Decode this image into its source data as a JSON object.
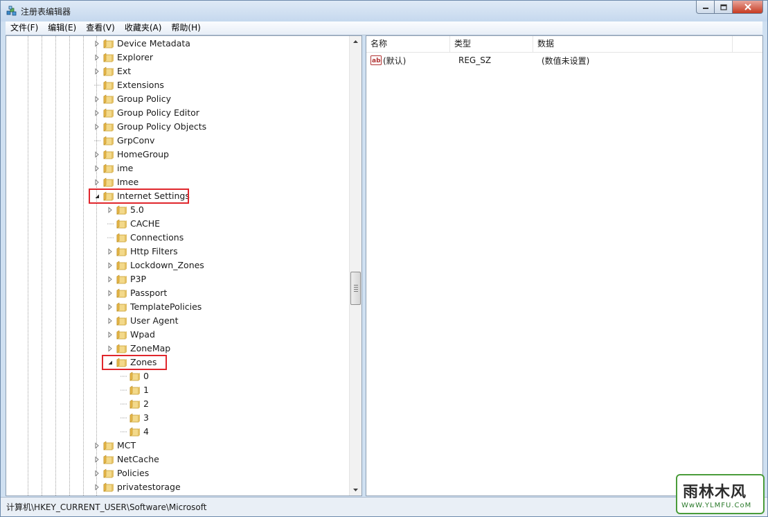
{
  "window": {
    "title": "注册表编辑器"
  },
  "menu": [
    "文件(F)",
    "编辑(E)",
    "查看(V)",
    "收藏夹(A)",
    "帮助(H)"
  ],
  "tree": [
    {
      "label": "Device Metadata",
      "level": 0,
      "expander": "collapsed"
    },
    {
      "label": "Explorer",
      "level": 0,
      "expander": "collapsed"
    },
    {
      "label": "Ext",
      "level": 0,
      "expander": "collapsed"
    },
    {
      "label": "Extensions",
      "level": 0,
      "expander": "none"
    },
    {
      "label": "Group Policy",
      "level": 0,
      "expander": "collapsed"
    },
    {
      "label": "Group Policy Editor",
      "level": 0,
      "expander": "collapsed"
    },
    {
      "label": "Group Policy Objects",
      "level": 0,
      "expander": "collapsed"
    },
    {
      "label": "GrpConv",
      "level": 0,
      "expander": "none"
    },
    {
      "label": "HomeGroup",
      "level": 0,
      "expander": "collapsed"
    },
    {
      "label": "ime",
      "level": 0,
      "expander": "collapsed"
    },
    {
      "label": "Imee",
      "level": 0,
      "expander": "collapsed"
    },
    {
      "label": "Internet Settings",
      "level": 0,
      "expander": "expanded",
      "highlight": true
    },
    {
      "label": "5.0",
      "level": 1,
      "expander": "collapsed"
    },
    {
      "label": "CACHE",
      "level": 1,
      "expander": "none"
    },
    {
      "label": "Connections",
      "level": 1,
      "expander": "none"
    },
    {
      "label": "Http Filters",
      "level": 1,
      "expander": "collapsed"
    },
    {
      "label": "Lockdown_Zones",
      "level": 1,
      "expander": "collapsed"
    },
    {
      "label": "P3P",
      "level": 1,
      "expander": "collapsed"
    },
    {
      "label": "Passport",
      "level": 1,
      "expander": "collapsed"
    },
    {
      "label": "TemplatePolicies",
      "level": 1,
      "expander": "collapsed"
    },
    {
      "label": "User Agent",
      "level": 1,
      "expander": "collapsed"
    },
    {
      "label": "Wpad",
      "level": 1,
      "expander": "collapsed"
    },
    {
      "label": "ZoneMap",
      "level": 1,
      "expander": "collapsed"
    },
    {
      "label": "Zones",
      "level": 1,
      "expander": "expanded",
      "highlight": true
    },
    {
      "label": "0",
      "level": 2,
      "expander": "none"
    },
    {
      "label": "1",
      "level": 2,
      "expander": "none"
    },
    {
      "label": "2",
      "level": 2,
      "expander": "none"
    },
    {
      "label": "3",
      "level": 2,
      "expander": "none"
    },
    {
      "label": "4",
      "level": 2,
      "expander": "none"
    },
    {
      "label": "MCT",
      "level": 0,
      "expander": "collapsed"
    },
    {
      "label": "NetCache",
      "level": 0,
      "expander": "collapsed"
    },
    {
      "label": "Policies",
      "level": 0,
      "expander": "collapsed"
    },
    {
      "label": "privatestorage",
      "level": 0,
      "expander": "collapsed"
    }
  ],
  "list": {
    "columns": [
      "名称",
      "类型",
      "数据"
    ],
    "rows": [
      {
        "name": "(默认)",
        "type": "REG_SZ",
        "data": "(数值未设置)",
        "icon": "string-value-icon"
      }
    ]
  },
  "status": {
    "path": "计算机\\HKEY_CURRENT_USER\\Software\\Microsoft"
  },
  "watermark": {
    "main": "雨林木风",
    "sub": "WwW.YLMFU.CoM"
  },
  "colors": {
    "highlight_border": "#e0262c",
    "folder": "#e8b84a"
  }
}
